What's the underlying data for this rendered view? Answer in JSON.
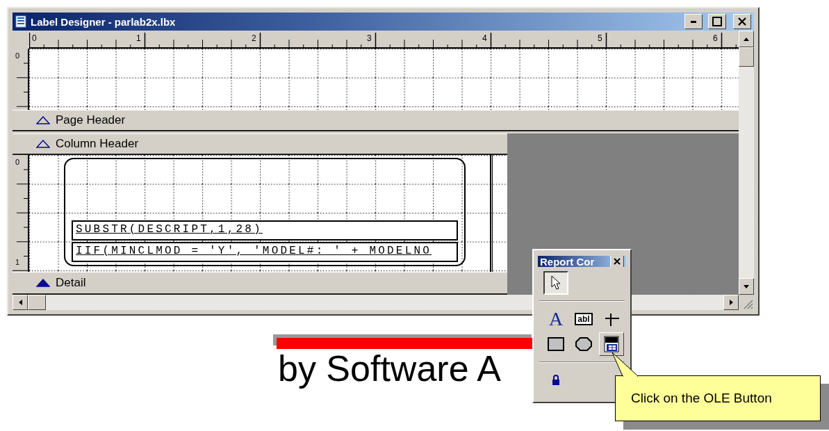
{
  "window": {
    "title": "Label Designer - parlab2x.lbx"
  },
  "ruler": {
    "marks": [
      "0",
      "1",
      "2",
      "3",
      "4",
      "5",
      "6"
    ]
  },
  "page_header": {
    "ruler_marks": [
      "0"
    ]
  },
  "bands": [
    {
      "label": "Page Header",
      "selected": false
    },
    {
      "label": "Column Header",
      "selected": false
    },
    {
      "label": "Detail",
      "selected": true
    }
  ],
  "detail": {
    "ruler_marks": [
      "0",
      "1"
    ],
    "fields": [
      "SUBSTR(DESCRIPT,1,28)",
      "IIF(MINCLMOD = 'Y', 'MODEL#: ' + MODELNO"
    ]
  },
  "palette": {
    "title": "Report Cor",
    "tool_groups": [
      [
        {
          "kind": "pointer",
          "selected": true,
          "hovered": false
        }
      ],
      [
        {
          "kind": "label",
          "glyph": "A",
          "selected": false,
          "hovered": false
        },
        {
          "kind": "field",
          "glyph": "abl",
          "selected": false,
          "hovered": false
        },
        {
          "kind": "line",
          "selected": false,
          "hovered": false
        },
        {
          "kind": "rectangle",
          "selected": false,
          "hovered": false
        },
        {
          "kind": "ellipse",
          "selected": false,
          "hovered": false
        },
        {
          "kind": "ole",
          "selected": false,
          "hovered": true
        }
      ],
      [
        {
          "kind": "lock",
          "selected": false,
          "hovered": false
        }
      ]
    ]
  },
  "callout": {
    "text": "Click on the OLE Button"
  },
  "background_logo": {
    "tagline": "by Software A"
  }
}
